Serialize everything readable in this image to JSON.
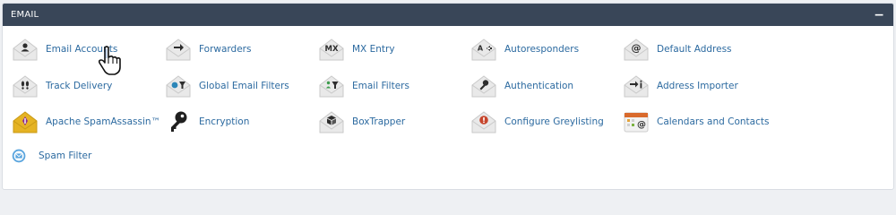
{
  "panel": {
    "title": "EMAIL",
    "collapse_label": "−"
  },
  "items": [
    {
      "label": "Email Accounts",
      "icon": "user-envelope-icon"
    },
    {
      "label": "Forwarders",
      "icon": "arrow-right-envelope-icon"
    },
    {
      "label": "MX Entry",
      "icon": "mx-envelope-icon"
    },
    {
      "label": "Autoresponders",
      "icon": "autoresponder-envelope-icon"
    },
    {
      "label": "Default Address",
      "icon": "at-envelope-icon"
    },
    {
      "label": "Track Delivery",
      "icon": "footprints-envelope-icon"
    },
    {
      "label": "Global Email Filters",
      "icon": "globe-filter-envelope-icon"
    },
    {
      "label": "Email Filters",
      "icon": "filter-envelope-icon"
    },
    {
      "label": "Authentication",
      "icon": "key-envelope-icon"
    },
    {
      "label": "Address Importer",
      "icon": "import-envelope-icon"
    },
    {
      "label": "Apache SpamAssassin™",
      "icon": "spamassassin-envelope-icon"
    },
    {
      "label": "Encryption",
      "icon": "key-icon"
    },
    {
      "label": "BoxTrapper",
      "icon": "box-envelope-icon"
    },
    {
      "label": "Configure Greylisting",
      "icon": "warning-envelope-icon"
    },
    {
      "label": "Calendars and Contacts",
      "icon": "calendar-contacts-icon"
    },
    {
      "label": "Spam Filter",
      "icon": "spam-filter-icon"
    }
  ],
  "colors": {
    "header_bg": "#394658",
    "link": "#2c6aa0",
    "icon_dark": "#2d2d2d",
    "envelope": "#e9e9e9",
    "spamassassin": "#e5b323",
    "greylisting": "#c6452c",
    "spam_filter": "#5aa5de"
  }
}
